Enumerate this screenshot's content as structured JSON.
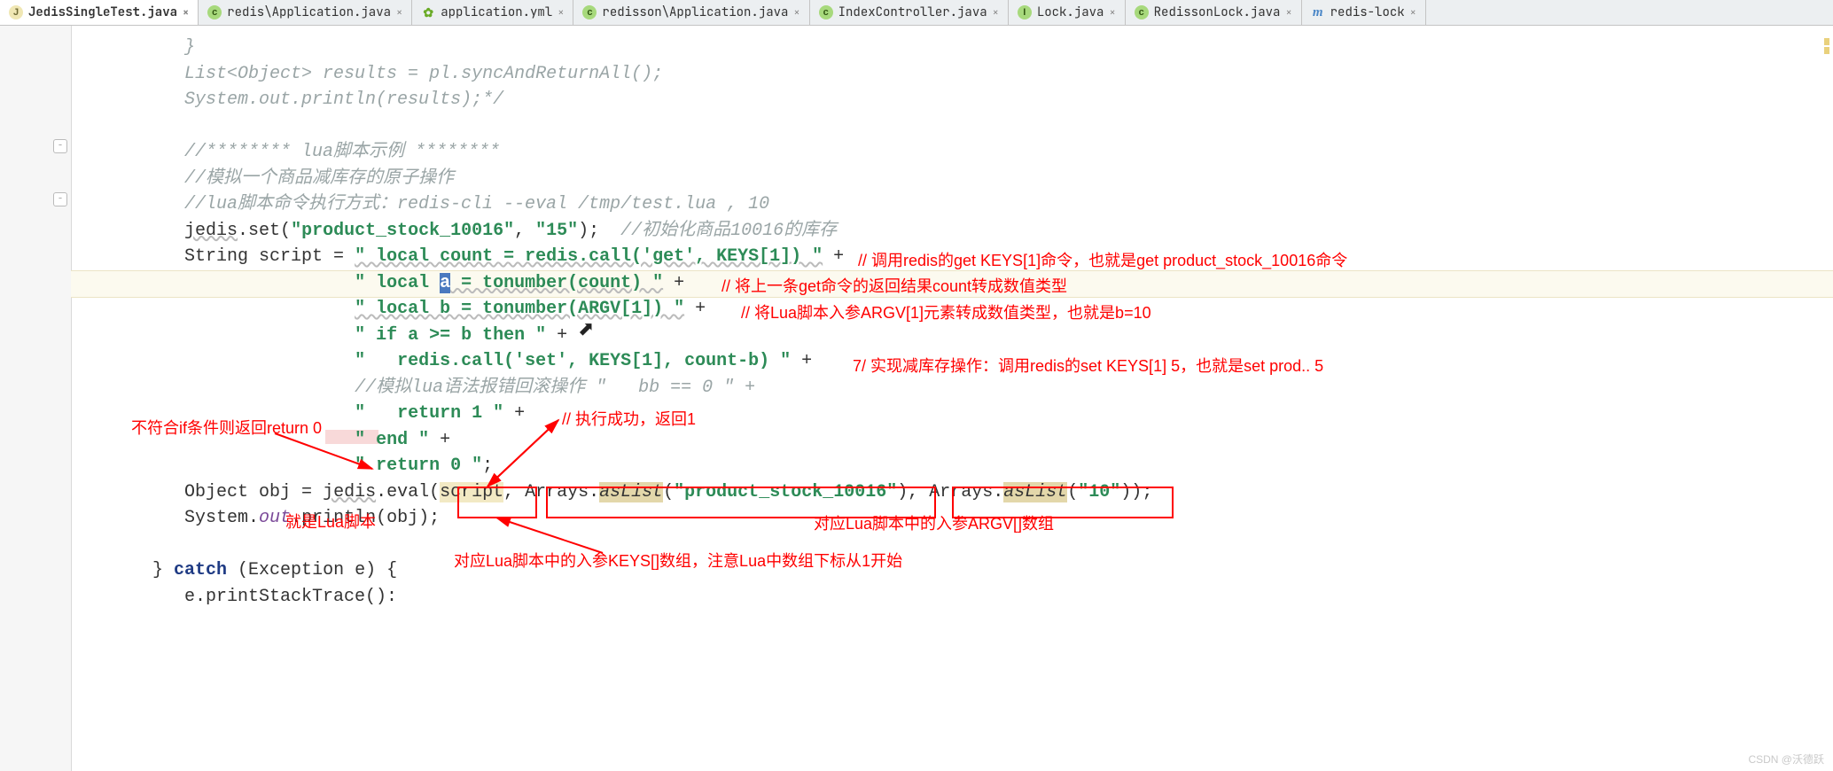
{
  "tabs": [
    {
      "icon": "j",
      "label": "JedisSingleTest.java",
      "active": true
    },
    {
      "icon": "c",
      "label": "redis\\Application.java",
      "active": false
    },
    {
      "icon": "yml",
      "label": "application.yml",
      "active": false
    },
    {
      "icon": "c",
      "label": "redisson\\Application.java",
      "active": false
    },
    {
      "icon": "c",
      "label": "IndexController.java",
      "active": false
    },
    {
      "icon": "i",
      "label": "Lock.java",
      "active": false
    },
    {
      "icon": "c",
      "label": "RedissonLock.java",
      "active": false
    },
    {
      "icon": "m",
      "label": "redis-lock",
      "active": false
    }
  ],
  "code": {
    "l1": "         }",
    "l2": "         List<Object> results = pl.syncAndReturnAll();",
    "l3": "         System.out.println(results);*/",
    "l4": "",
    "l5": "         //******** lua脚本示例 ********",
    "l6": "         //模拟一个商品减库存的原子操作",
    "l7": "         //lua脚本命令执行方式：redis-cli --eval /tmp/test.lua , 10",
    "l8a": "jedis",
    "l8b": ".set(",
    "l8c": "\"product_stock_10016\"",
    "l8d": ", ",
    "l8e": "\"15\"",
    "l8f": ");  ",
    "l8g": "//初始化商品10016的库存",
    "l9a": "String script = ",
    "l9b": "\" local count = redis.call('get', KEYS[1]) \"",
    "l9c": " +",
    "l10a": "\" local ",
    "l10b": "a",
    "l10c": " = tonumber(count) \"",
    "l10d": " + ",
    "l11a": "\" local b = tonumber(ARGV[1]) \"",
    "l11b": " + ",
    "l12a": "\" if a >= b then \"",
    "l12b": " +",
    "l13a": "\"   redis.call('set', KEYS[1], count-b) \"",
    "l13b": " +",
    "l14a": "//模拟lua语法报错回滚操作 \"   bb == 0 \" +",
    "l15a": "\"   return 1 \"",
    "l15b": " + ",
    "l16a": "\" end \"",
    "l16b": " +",
    "l17a": "\" return 0 \"",
    "l17b": ";",
    "l18a": "Object obj = ",
    "l18b": "jedis",
    "l18c": ".eval(",
    "l18d": "script",
    "l18e": ", Arrays.",
    "l18f": "asList",
    "l18g": "(",
    "l18h": "\"product_stock_10016\"",
    "l18i": "), Arrays.",
    "l18j": "asList",
    "l18k": "(",
    "l18l": "\"10\"",
    "l18m": "))",
    ";": ";",
    "l19a": "System.",
    "l19b": "out",
    "l19c": ".println(obj);",
    "l21a": "} ",
    "l21b": "catch",
    "l21c": " (Exception e) {",
    "l22": "   e.printStackTrace():"
  },
  "ann": {
    "a1": "// 调用redis的get KEYS[1]命令，也就是get product_stock_10016命令",
    "a2": "// 将上一条get命令的返回结果count转成数值类型",
    "a3": "// 将Lua脚本入参ARGV[1]元素转成数值类型，也就是b=10",
    "a4": "7/ 实现减库存操作：调用redis的set KEYS[1] 5，也就是set prod.. 5",
    "a5": "// 执行成功，返回1",
    "a6": "不符合if条件则返回return 0",
    "a7": "就是Lua脚本",
    "a8": "对应Lua脚本中的入参KEYS[]数组，注意Lua中数组下标从1开始",
    "a9": "对应Lua脚本中的入参ARGV[]数组"
  },
  "watermark": "CSDN @沃德跃"
}
